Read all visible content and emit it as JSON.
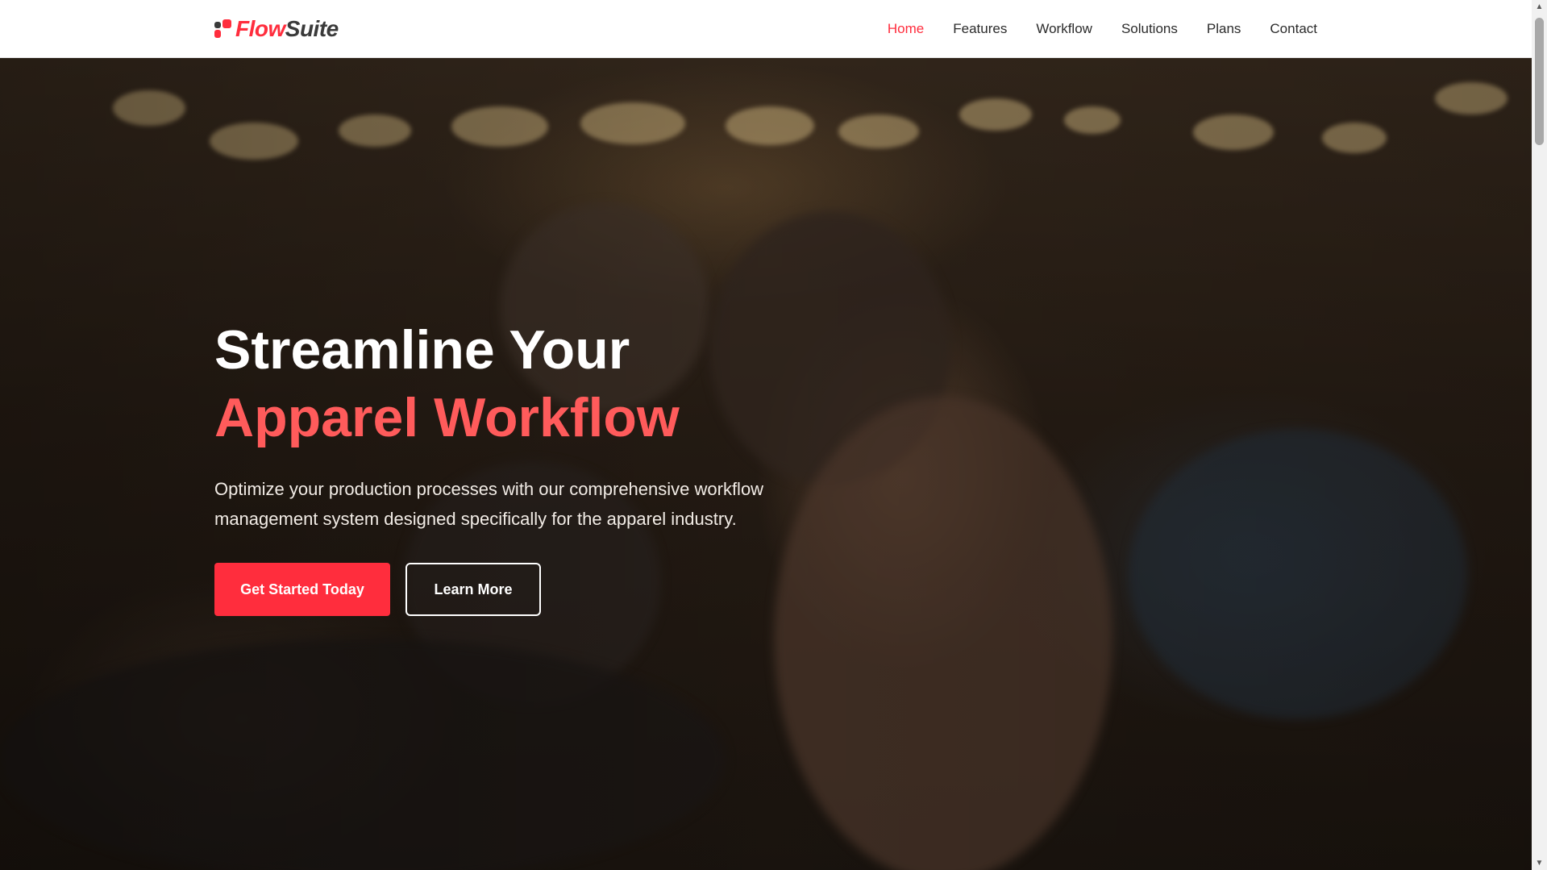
{
  "header": {
    "logo": {
      "part1": "Flow",
      "part2": "Suite"
    },
    "nav": [
      {
        "label": "Home",
        "active": true
      },
      {
        "label": "Features",
        "active": false
      },
      {
        "label": "Workflow",
        "active": false
      },
      {
        "label": "Solutions",
        "active": false
      },
      {
        "label": "Plans",
        "active": false
      },
      {
        "label": "Contact",
        "active": false
      }
    ]
  },
  "hero": {
    "title_line1": "Streamline Your",
    "title_line2": "Apparel Workflow",
    "subtitle": "Optimize your production processes with our comprehensive workflow management system designed specifically for the apparel industry.",
    "primary_button": "Get Started Today",
    "secondary_button": "Learn More"
  },
  "colors": {
    "accent": "#ff2d3d",
    "title_accent": "#ff5b5b",
    "text_dark": "#2b2b2b"
  }
}
